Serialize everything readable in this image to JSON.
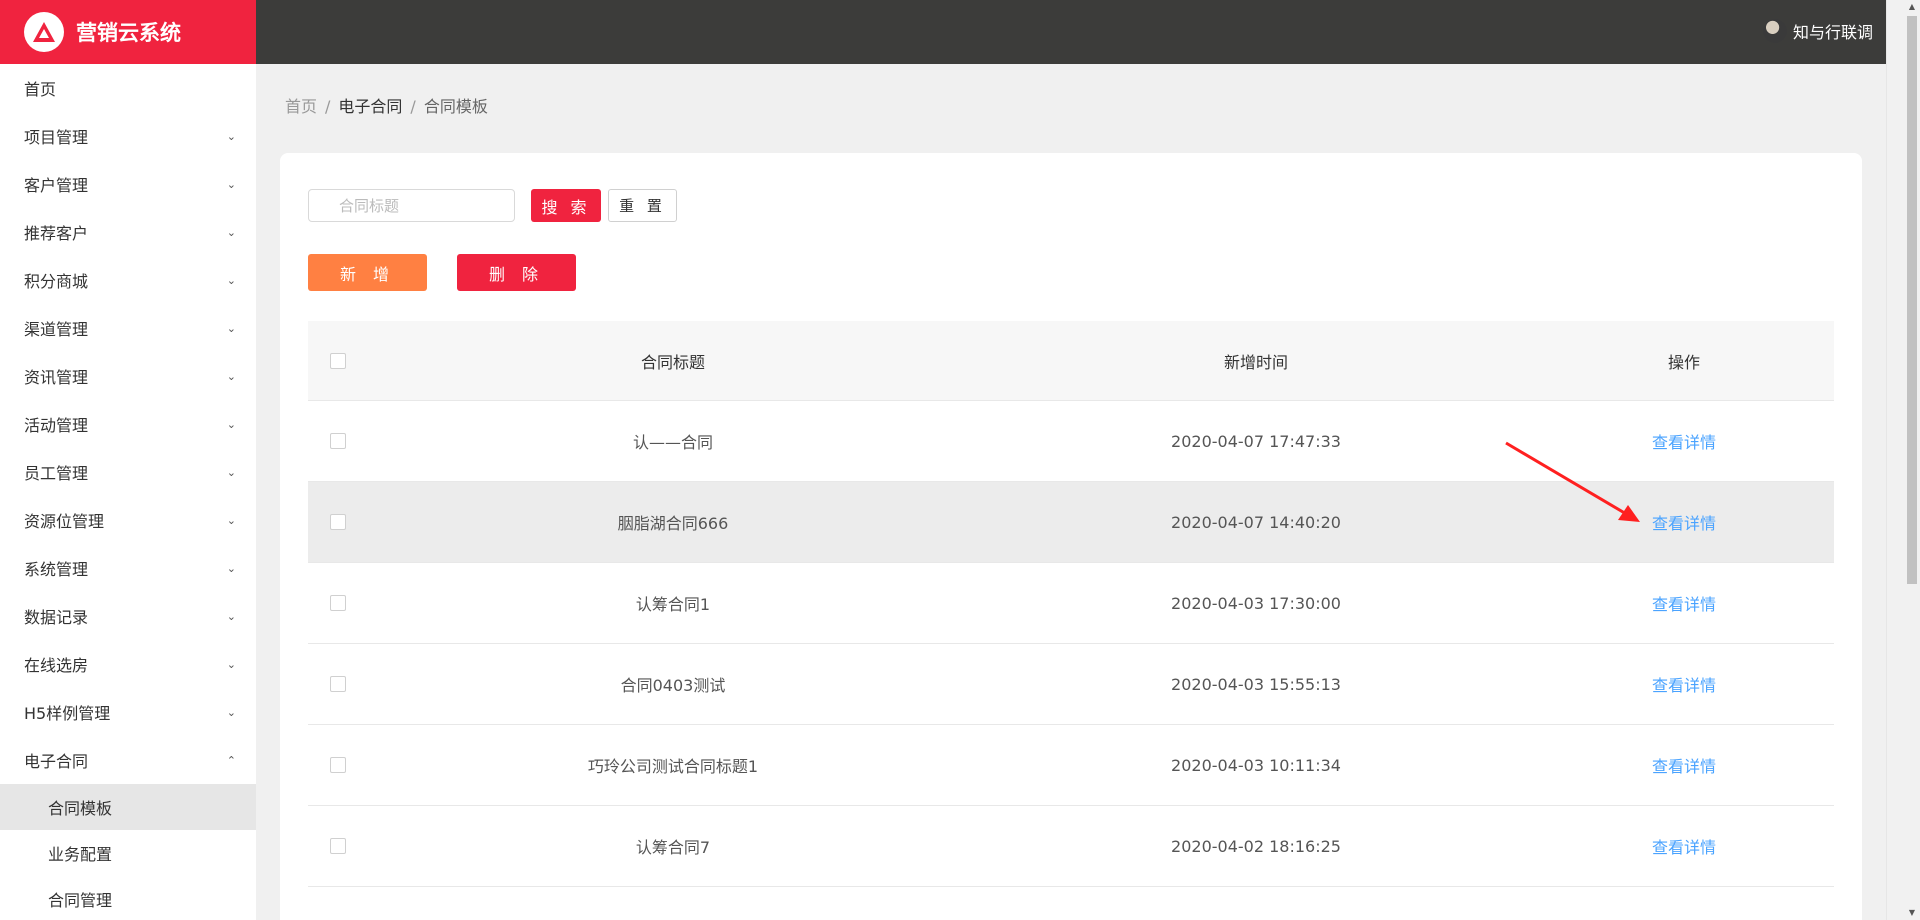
{
  "app": {
    "title": "营销云系统",
    "brand_color": "#f0233f",
    "logo_icon": "triangle-logo-icon"
  },
  "header": {
    "username": "知与行联调"
  },
  "sidebar": {
    "items": [
      {
        "label": "首页",
        "expandable": false
      },
      {
        "label": "项目管理",
        "expandable": true
      },
      {
        "label": "客户管理",
        "expandable": true
      },
      {
        "label": "推荐客户",
        "expandable": true
      },
      {
        "label": "积分商城",
        "expandable": true
      },
      {
        "label": "渠道管理",
        "expandable": true
      },
      {
        "label": "资讯管理",
        "expandable": true
      },
      {
        "label": "活动管理",
        "expandable": true
      },
      {
        "label": "员工管理",
        "expandable": true
      },
      {
        "label": "资源位管理",
        "expandable": true
      },
      {
        "label": "系统管理",
        "expandable": true
      },
      {
        "label": "数据记录",
        "expandable": true
      },
      {
        "label": "在线选房",
        "expandable": true
      },
      {
        "label": "H5样例管理",
        "expandable": true
      },
      {
        "label": "电子合同",
        "expandable": true,
        "expanded": true
      }
    ],
    "sub_items": [
      {
        "label": "合同模板",
        "active": true
      },
      {
        "label": "业务配置"
      },
      {
        "label": "合同管理"
      }
    ]
  },
  "breadcrumb": {
    "home": "首页",
    "section": "电子合同",
    "current": "合同模板",
    "separator": "/"
  },
  "search": {
    "placeholder": "合同标题",
    "value": "",
    "search_label": "搜 索",
    "reset_label": "重 置"
  },
  "actions": {
    "add_label": "新 增",
    "delete_label": "删 除",
    "add_color": "#ff8042",
    "delete_color": "#f0233f"
  },
  "table": {
    "headers": {
      "title": "合同标题",
      "time": "新增时间",
      "op": "操作"
    },
    "rows": [
      {
        "title": "认——合同",
        "time": "2020-04-07 17:47:33",
        "op": "查看详情"
      },
      {
        "title": "胭脂湖合同666",
        "time": "2020-04-07 14:40:20",
        "op": "查看详情"
      },
      {
        "title": "认筹合同1",
        "time": "2020-04-03 17:30:00",
        "op": "查看详情"
      },
      {
        "title": "合同0403测试",
        "time": "2020-04-03 15:55:13",
        "op": "查看详情"
      },
      {
        "title": "巧玲公司测试合同标题1",
        "time": "2020-04-03 10:11:34",
        "op": "查看详情"
      },
      {
        "title": "认筹合同7",
        "time": "2020-04-02 18:16:25",
        "op": "查看详情"
      }
    ],
    "link_color": "#4aa3ff"
  }
}
